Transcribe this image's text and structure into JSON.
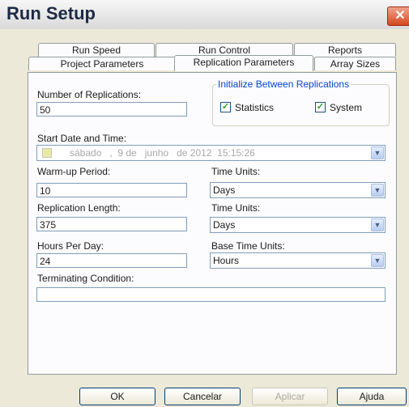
{
  "window": {
    "title": "Run Setup",
    "close_glyph": "✕"
  },
  "tabs_row1": [
    {
      "label": "Run Speed"
    },
    {
      "label": "Run Control"
    },
    {
      "label": "Reports"
    }
  ],
  "tabs_row2": [
    {
      "label": "Project Parameters"
    },
    {
      "label": "Replication Parameters",
      "active": true
    },
    {
      "label": "Array Sizes"
    }
  ],
  "form": {
    "replications_label": "Number of Replications:",
    "replications_value": "50",
    "init_group_label": "Initialize Between Replications",
    "statistics_label": "Statistics",
    "statistics_checked": true,
    "system_label": "System",
    "system_checked": true,
    "start_label": "Start Date and Time:",
    "start_value": "sábado   ,  9 de   junho   de 2012  15:15:26",
    "warmup_label": "Warm-up Period:",
    "warmup_value": "10",
    "warmup_units_label": "Time Units:",
    "warmup_units_value": "Days",
    "replen_label": "Replication Length:",
    "replen_value": "375",
    "replen_units_label": "Time Units:",
    "replen_units_value": "Days",
    "hours_label": "Hours Per Day:",
    "hours_value": "24",
    "base_units_label": "Base Time Units:",
    "base_units_value": "Hours",
    "terminating_label": "Terminating Condition:",
    "terminating_value": ""
  },
  "buttons": {
    "ok": "OK",
    "cancel": "Cancelar",
    "apply": "Aplicar",
    "help": "Ajuda"
  },
  "icons": {
    "dropdown": "chevron-down-icon",
    "check": "checkmark-icon"
  }
}
